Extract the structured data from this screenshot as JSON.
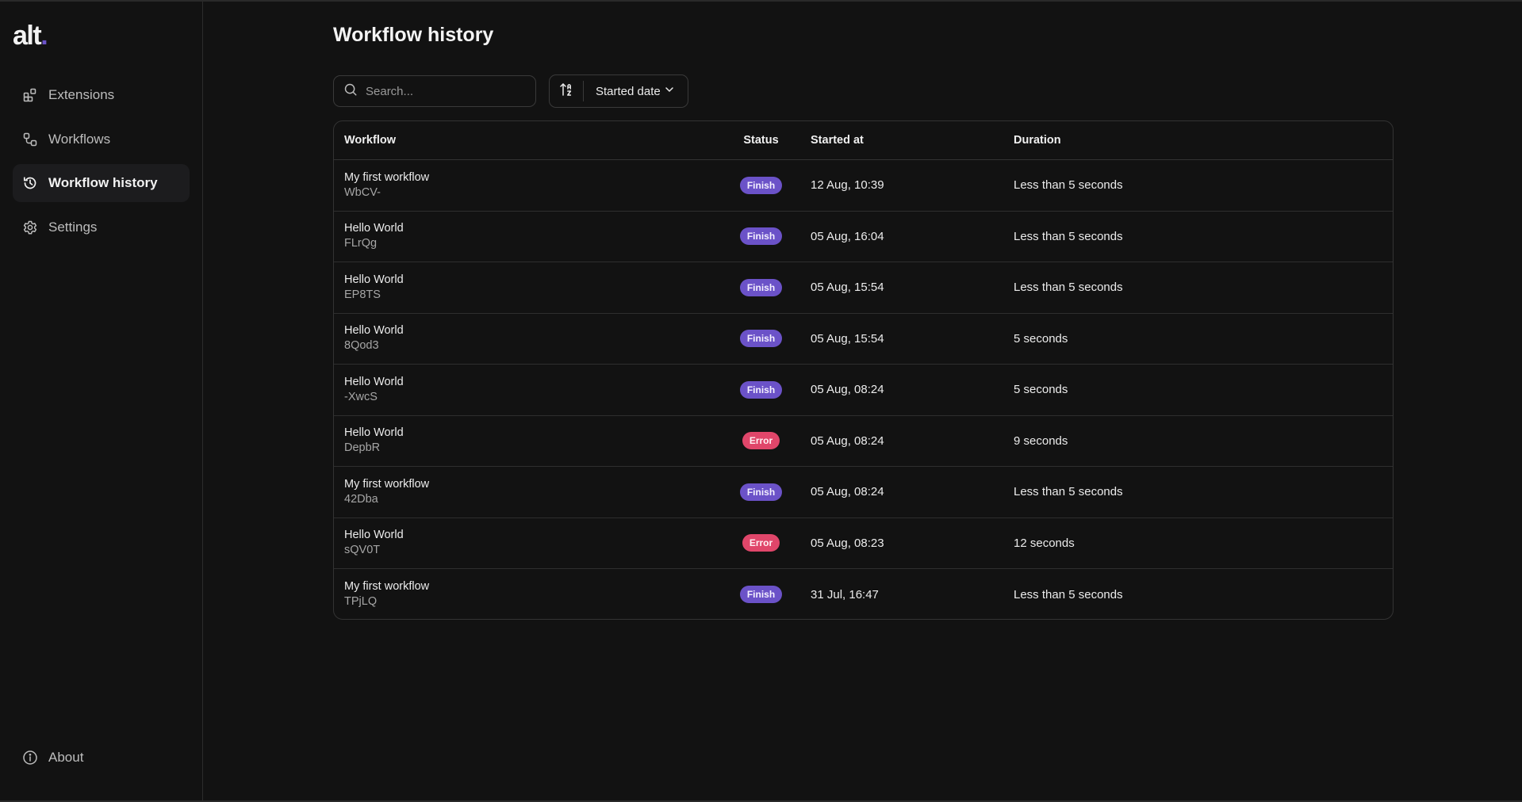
{
  "app": {
    "logo_text": "alt",
    "logo_dot": ".",
    "accent_color": "#6b52c8"
  },
  "sidebar": {
    "items": [
      {
        "label": "Extensions",
        "icon": "extensions-icon",
        "active": false
      },
      {
        "label": "Workflows",
        "icon": "workflows-icon",
        "active": false
      },
      {
        "label": "Workflow history",
        "icon": "history-icon",
        "active": true
      },
      {
        "label": "Settings",
        "icon": "gear-icon",
        "active": false
      }
    ],
    "footer": {
      "label": "About",
      "icon": "info-icon"
    }
  },
  "main": {
    "title": "Workflow history",
    "search": {
      "placeholder": "Search...",
      "value": ""
    },
    "sort": {
      "direction_icon": "sort-ascending-az-icon",
      "field": "Started date"
    },
    "table": {
      "columns": [
        "Workflow",
        "Status",
        "Started at",
        "Duration"
      ],
      "rows": [
        {
          "name": "My first workflow",
          "id": "WbCV-",
          "status": "Finish",
          "started": "12 Aug, 10:39",
          "duration": "Less than 5 seconds"
        },
        {
          "name": "Hello World",
          "id": "FLrQg",
          "status": "Finish",
          "started": "05 Aug, 16:04",
          "duration": "Less than 5 seconds"
        },
        {
          "name": "Hello World",
          "id": "EP8TS",
          "status": "Finish",
          "started": "05 Aug, 15:54",
          "duration": "Less than 5 seconds"
        },
        {
          "name": "Hello World",
          "id": "8Qod3",
          "status": "Finish",
          "started": "05 Aug, 15:54",
          "duration": "5 seconds"
        },
        {
          "name": "Hello World",
          "id": "-XwcS",
          "status": "Finish",
          "started": "05 Aug, 08:24",
          "duration": "5 seconds"
        },
        {
          "name": "Hello World",
          "id": "DepbR",
          "status": "Error",
          "started": "05 Aug, 08:24",
          "duration": "9 seconds"
        },
        {
          "name": "My first workflow",
          "id": "42Dba",
          "status": "Finish",
          "started": "05 Aug, 08:24",
          "duration": "Less than 5 seconds"
        },
        {
          "name": "Hello World",
          "id": "sQV0T",
          "status": "Error",
          "started": "05 Aug, 08:23",
          "duration": "12 seconds"
        },
        {
          "name": "My first workflow",
          "id": "TPjLQ",
          "status": "Finish",
          "started": "31 Jul, 16:47",
          "duration": "Less than 5 seconds"
        }
      ]
    },
    "status_colors": {
      "Finish": "#6b52c8",
      "Error": "#e0466a"
    }
  }
}
